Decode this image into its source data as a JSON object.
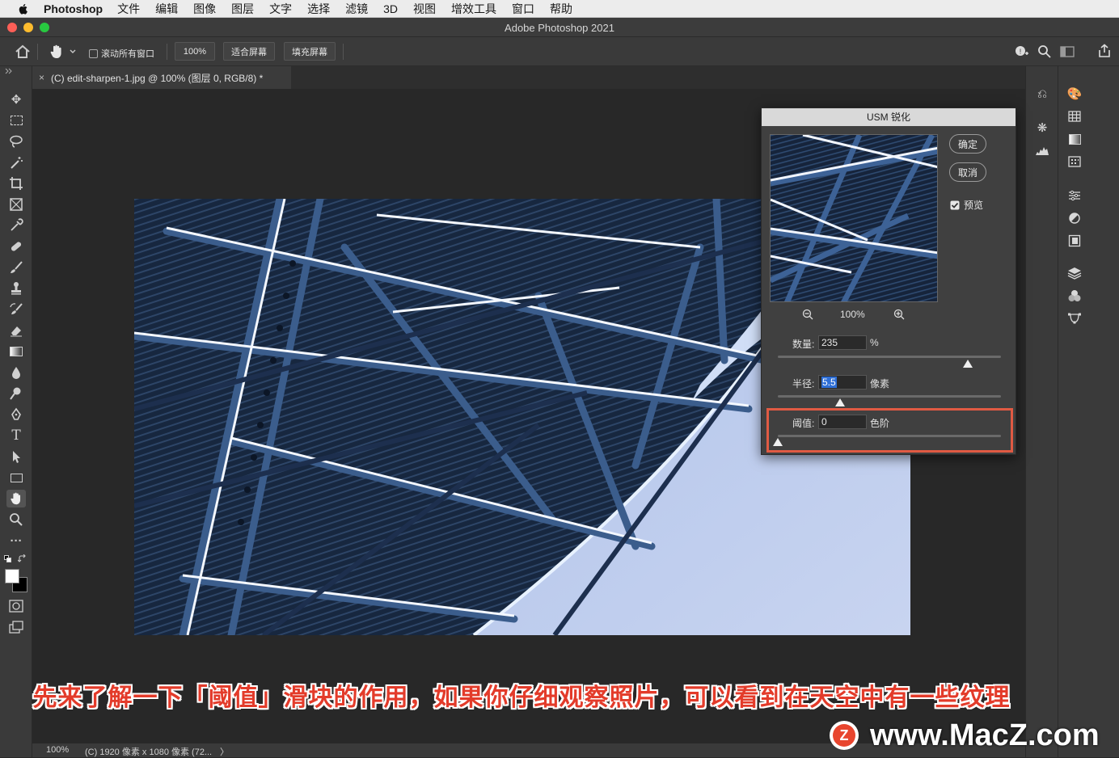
{
  "menubar": {
    "app_name": "Photoshop",
    "items": [
      "文件",
      "编辑",
      "图像",
      "图层",
      "文字",
      "选择",
      "滤镜",
      "3D",
      "视图",
      "增效工具",
      "窗口",
      "帮助"
    ]
  },
  "window": {
    "title": "Adobe Photoshop 2021"
  },
  "options_bar": {
    "scroll_all_label": "滚动所有窗口",
    "zoom_100_label": "100%",
    "fit_screen_label": "适合屏幕",
    "fill_screen_label": "填充屏幕"
  },
  "document_tab": {
    "close_glyph": "×",
    "title": "(C) edit-sharpen-1.jpg @ 100% (图层 0, RGB/8) *"
  },
  "dialog": {
    "title": "USM 锐化",
    "ok_label": "确定",
    "cancel_label": "取消",
    "preview_label": "预览",
    "preview_checked": true,
    "preview_zoom": "100%",
    "amount": {
      "label": "数量:",
      "value": "235",
      "unit": "%",
      "fraction": 0.85
    },
    "radius": {
      "label": "半径:",
      "value": "5.5",
      "unit": "像素",
      "fraction": 0.28
    },
    "threshold": {
      "label": "阈值:",
      "value": "0",
      "unit": "色阶",
      "fraction": 0.0
    }
  },
  "status_bar": {
    "zoom": "100%",
    "info": "(C) 1920 像素 x 1080 像素 (72...",
    "arrow": "〉"
  },
  "caption": "先来了解一下「阈值」滑块的作用，如果你仔细观察照片，可以看到在天空中有一些纹理",
  "watermark": {
    "text": "www.MacZ.com",
    "logo_letter": "Z"
  },
  "colors": {
    "accent_red": "#e05a43",
    "caption_red": "#e33b2a",
    "sky": "#b8c8ec",
    "steel": "#1a2b48"
  }
}
